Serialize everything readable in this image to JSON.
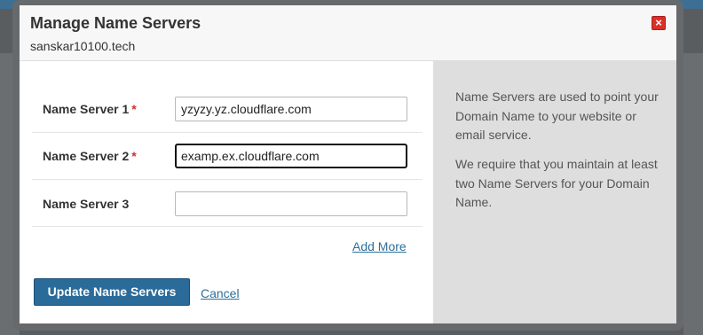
{
  "modal": {
    "title": "Manage Name Servers",
    "domain": "sanskar10100.tech",
    "close_glyph": "×"
  },
  "name_servers": [
    {
      "label": "Name Server 1",
      "required": true,
      "required_mark": "*",
      "value": "yzyzy.yz.cloudflare.com",
      "placeholder": ""
    },
    {
      "label": "Name Server 2",
      "required": true,
      "required_mark": "*",
      "value": "examp.ex.cloudflare.com",
      "placeholder": ""
    },
    {
      "label": "Name Server 3",
      "required": false,
      "required_mark": "",
      "value": "",
      "placeholder": ""
    }
  ],
  "actions": {
    "add_more": "Add More",
    "update": "Update Name Servers",
    "cancel": "Cancel"
  },
  "help": {
    "paragraph1": "Name Servers are used to point your Domain Name to your website or email service.",
    "paragraph2": "We require that you maintain at least two Name Servers for your Domain Name."
  },
  "colors": {
    "primary_button": "#2a6b9a",
    "link": "#2e6f99",
    "required": "#c9302c",
    "close_button": "#d9302a",
    "help_panel": "#dedede"
  }
}
